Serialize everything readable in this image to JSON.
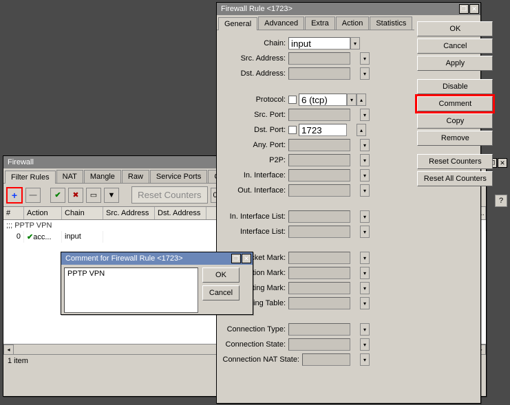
{
  "firewall_window": {
    "title": "Firewall",
    "tabs": [
      "Filter Rules",
      "NAT",
      "Mangle",
      "Raw",
      "Service Ports",
      "Connections"
    ],
    "active_tab": 0,
    "reset_counters": "Reset Counters",
    "columns": [
      "#",
      "Action",
      "Chain",
      "Src. Address",
      "Dst. Address",
      "Pack..."
    ],
    "group_label": ";;; PPTP VPN",
    "row": {
      "num": "0",
      "action": "acc...",
      "chain": "input"
    },
    "status": "1 item"
  },
  "rule_dialog": {
    "title": "Firewall Rule <1723>",
    "tabs": [
      "General",
      "Advanced",
      "Extra",
      "Action",
      "Statistics"
    ],
    "active_tab": 0,
    "fields": {
      "chain_label": "Chain:",
      "chain_value": "input",
      "src_address_label": "Src. Address:",
      "dst_address_label": "Dst. Address:",
      "protocol_label": "Protocol:",
      "protocol_value": "6 (tcp)",
      "src_port_label": "Src. Port:",
      "dst_port_label": "Dst. Port:",
      "dst_port_value": "1723",
      "any_port_label": "Any. Port:",
      "p2p_label": "P2P:",
      "in_interface_label": "In. Interface:",
      "out_interface_label": "Out. Interface:",
      "in_interface_list_label": "In. Interface List:",
      "out_interface_list_label": "Interface List:",
      "packet_mark_label": "Packet Mark:",
      "connection_mark_label": "nection Mark:",
      "routing_mark_label": "Routing Mark:",
      "routing_table_label": "Routing Table:",
      "connection_type_label": "Connection Type:",
      "connection_state_label": "Connection State:",
      "connection_nat_state_label": "Connection NAT State:"
    },
    "buttons": {
      "ok": "OK",
      "cancel": "Cancel",
      "apply": "Apply",
      "disable": "Disable",
      "comment": "Comment",
      "copy": "Copy",
      "remove": "Remove",
      "reset_counters": "Reset Counters",
      "reset_all_counters": "Reset All Counters"
    }
  },
  "comment_dialog": {
    "title": "Comment for Firewall Rule <1723>",
    "value": "PPTP VPN",
    "ok": "OK",
    "cancel": "Cancel"
  }
}
